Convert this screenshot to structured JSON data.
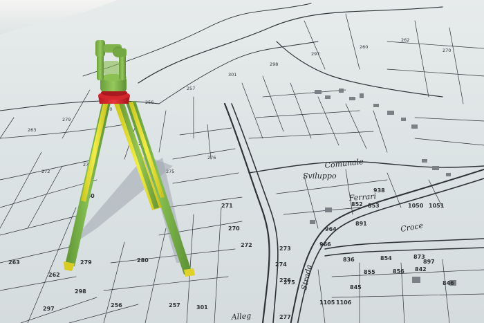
{
  "scene": {
    "subject": "surveyor tripod with green theodolite standing on an old cadastral map",
    "colors": {
      "paper": "#dfe5e6",
      "ink": "#2b2f33",
      "instrument_green": "#7fb24a",
      "tripod_head_red": "#d8202a",
      "leg_yellow": "#e6e032",
      "leg_green": "#76ad44",
      "shadow": "#9aa3ab"
    }
  },
  "map": {
    "place_labels": [
      {
        "text": "Sviluppo"
      },
      {
        "text": "Comunale"
      },
      {
        "text": "Ferrari"
      },
      {
        "text": "Croce"
      },
      {
        "text": "Alleg"
      },
      {
        "text": "Strada"
      }
    ],
    "parcel_numbers": [
      "263",
      "279",
      "280",
      "256",
      "257",
      "301",
      "298",
      "297",
      "260",
      "262",
      "270",
      "272",
      "273",
      "274",
      "275",
      "276",
      "277",
      "271",
      "852",
      "853",
      "891",
      "897",
      "836",
      "845",
      "846",
      "842",
      "855",
      "856",
      "1050",
      "1051",
      "966",
      "964",
      "938",
      "1105",
      "1106",
      "854",
      "873"
    ]
  }
}
